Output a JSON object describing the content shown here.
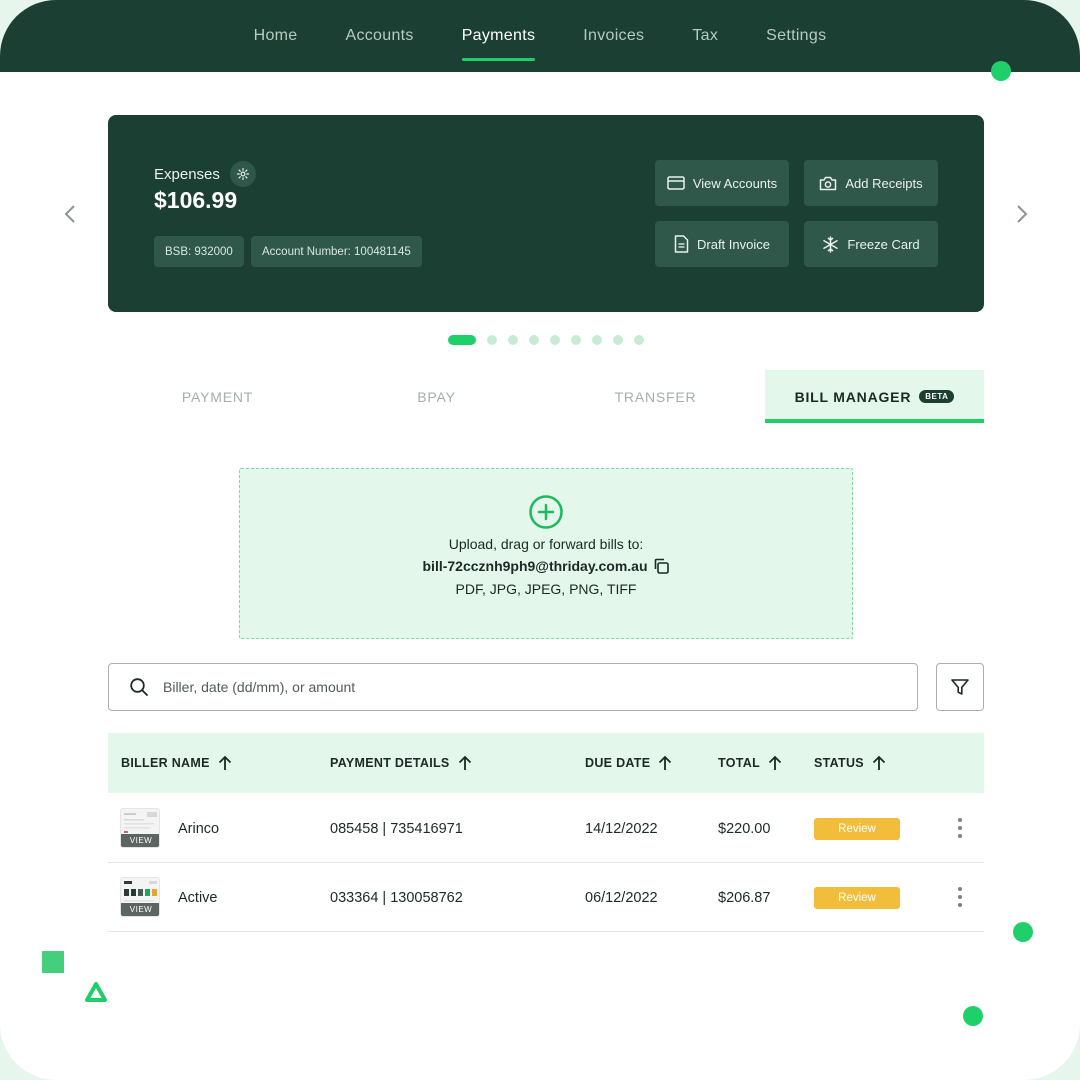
{
  "nav": {
    "items": [
      {
        "label": "Home"
      },
      {
        "label": "Accounts"
      },
      {
        "label": "Payments"
      },
      {
        "label": "Invoices"
      },
      {
        "label": "Tax"
      },
      {
        "label": "Settings"
      }
    ],
    "active": "Payments"
  },
  "account": {
    "label": "Expenses",
    "balance": "$106.99",
    "bsb": "BSB: 932000",
    "account_number": "Account Number: 100481145",
    "actions": {
      "view_accounts": "View Accounts",
      "add_receipts": "Add Receipts",
      "draft_invoice": "Draft Invoice",
      "freeze_card": "Freeze Card"
    }
  },
  "carousel": {
    "total": 10,
    "active_index": 0
  },
  "tabs": {
    "payment": "PAYMENT",
    "bpay": "BPAY",
    "transfer": "TRANSFER",
    "bill_manager": "BILL MANAGER",
    "beta": "BETA"
  },
  "upload": {
    "line1": "Upload, drag or forward bills to:",
    "email": "bill-72ccznh9ph9@thriday.com.au",
    "types": "PDF, JPG, JPEG, PNG, TIFF"
  },
  "search": {
    "placeholder": "Biller, date (dd/mm), or amount"
  },
  "table": {
    "headers": {
      "biller": "BILLER NAME",
      "payment": "PAYMENT DETAILS",
      "due": "DUE DATE",
      "total": "TOTAL",
      "status": "STATUS"
    },
    "thumb_label": "VIEW",
    "rows": [
      {
        "biller": "Arinco",
        "payment": "085458 | 735416971",
        "due": "14/12/2022",
        "total": "$220.00",
        "status": "Review"
      },
      {
        "biller": "Active",
        "payment": "033364 | 130058762",
        "due": "06/12/2022",
        "total": "$206.87",
        "status": "Review"
      }
    ]
  },
  "colors": {
    "brand_dark": "#1b3f33",
    "accent": "#1fd06a",
    "review_badge": "#f2bd3b",
    "tint": "#e3f7ea"
  }
}
